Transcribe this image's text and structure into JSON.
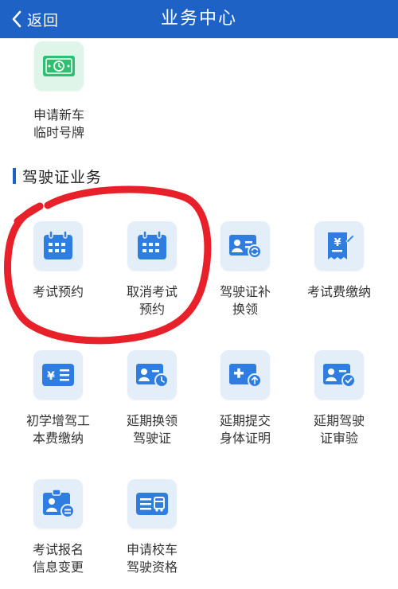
{
  "header": {
    "back_label": "返回",
    "title": "业务中心"
  },
  "top_item": {
    "label": "申请新车\n临时号牌"
  },
  "section": {
    "title": "驾驶证业务"
  },
  "tiles": [
    {
      "label": "考试预约"
    },
    {
      "label": "取消考试\n预约"
    },
    {
      "label": "驾驶证补\n换领"
    },
    {
      "label": "考试费缴纳"
    },
    {
      "label": "初学增驾工\n本费缴纳"
    },
    {
      "label": "延期换领\n驾驶证"
    },
    {
      "label": "延期提交\n身体证明"
    },
    {
      "label": "延期驾驶\n证审验"
    },
    {
      "label": "考试报名\n信息变更"
    },
    {
      "label": "申请校车\n驾驶资格"
    }
  ],
  "colors": {
    "header_bg": "#1f62c6",
    "icon_blue": "#2f7de1",
    "icon_green": "#2fbf71",
    "annotation_red": "#e8202a"
  }
}
